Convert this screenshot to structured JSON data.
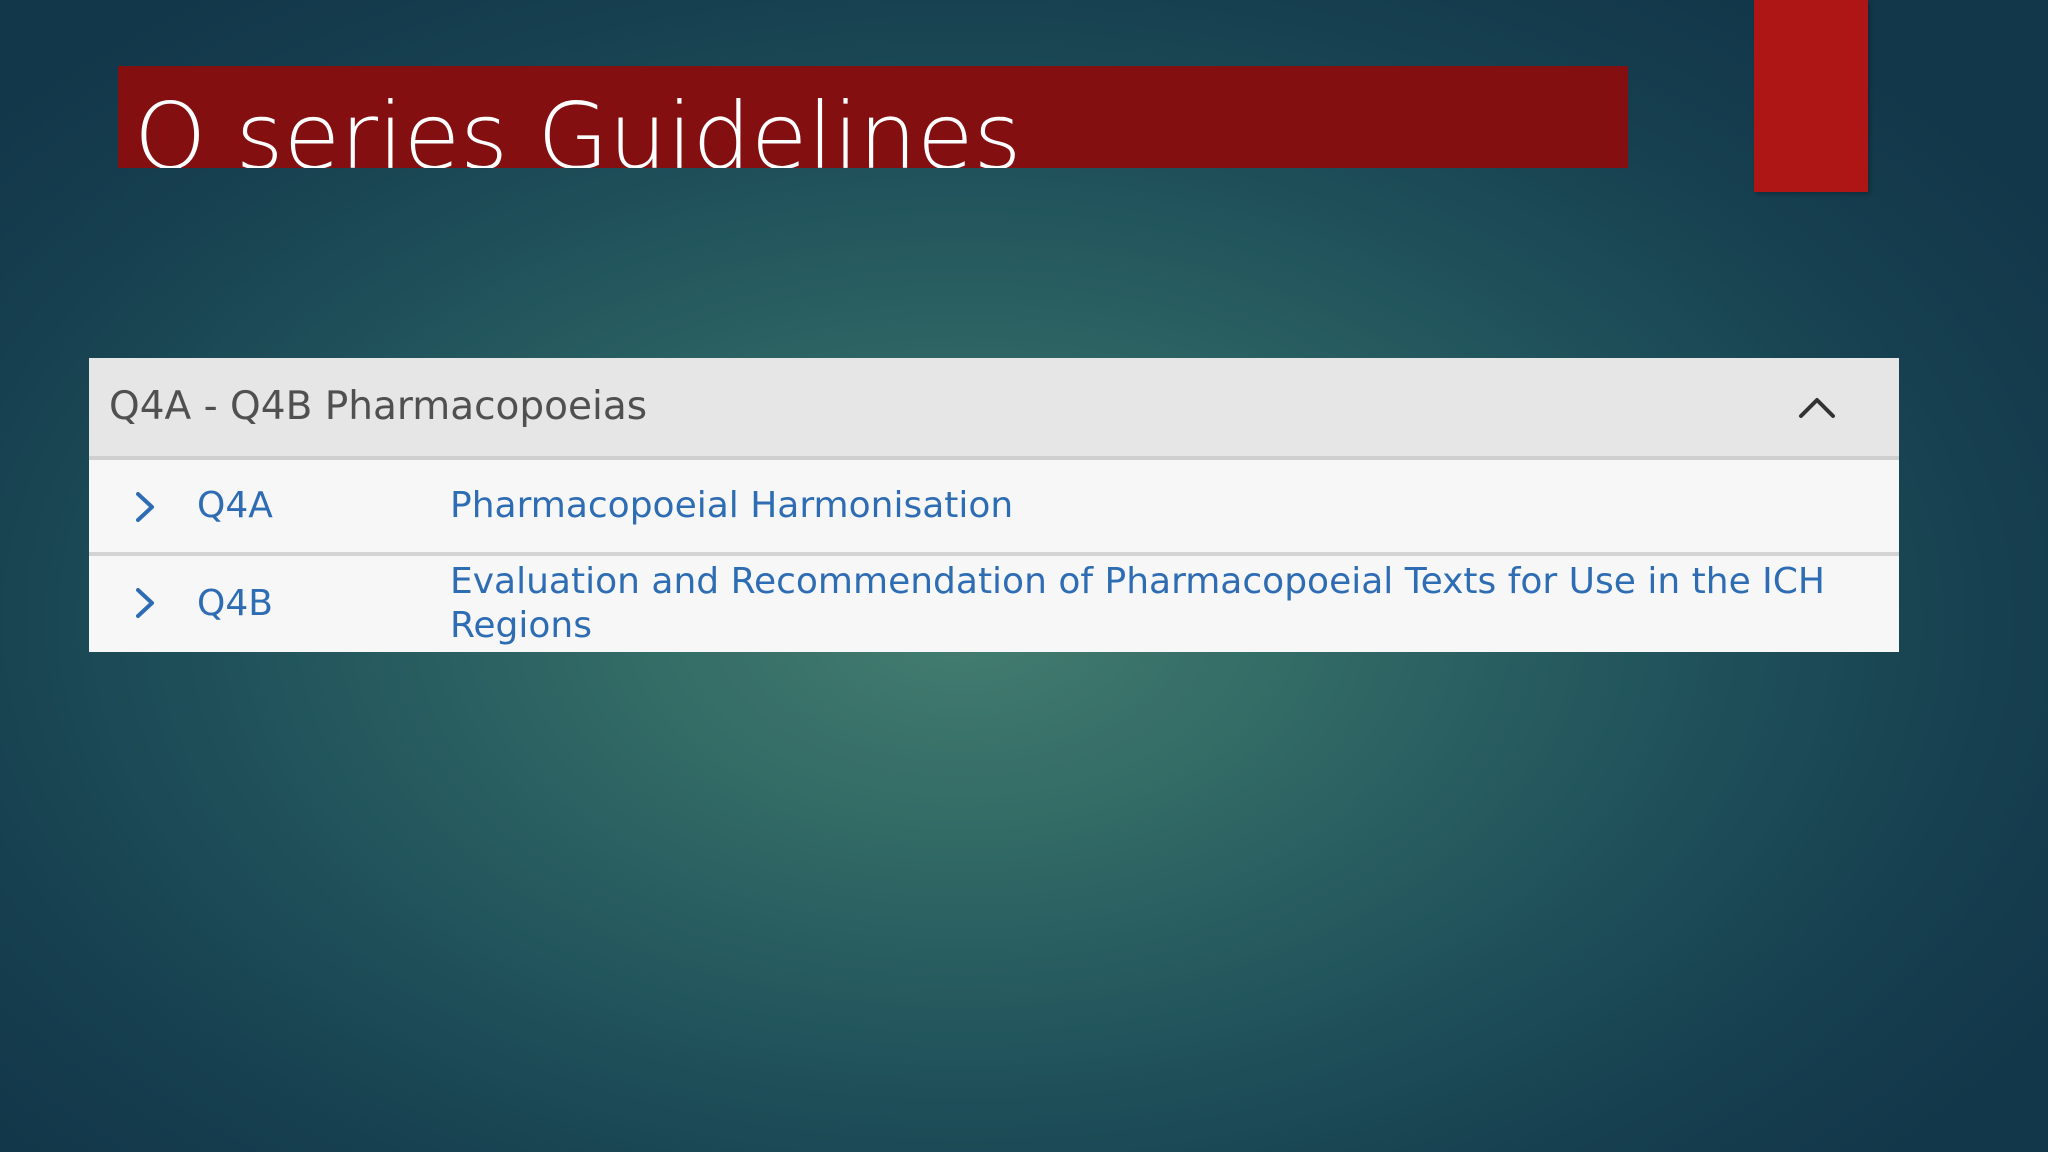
{
  "slide": {
    "title": "Q series Guidelines",
    "colors": {
      "title_bar": "#830f10",
      "accent_block": "#ad1615",
      "link": "#2e6db4"
    }
  },
  "accordion": {
    "header_title": "Q4A - Q4B Pharmacopoeias",
    "collapse_icon": "chevron-up-icon",
    "rows": [
      {
        "icon": "chevron-right-icon",
        "code": "Q4A",
        "description": "Pharmacopoeial Harmonisation"
      },
      {
        "icon": "chevron-right-icon",
        "code": "Q4B",
        "description": "Evaluation and Recommendation of Pharmacopoeial Texts for Use in the ICH Regions"
      }
    ]
  }
}
